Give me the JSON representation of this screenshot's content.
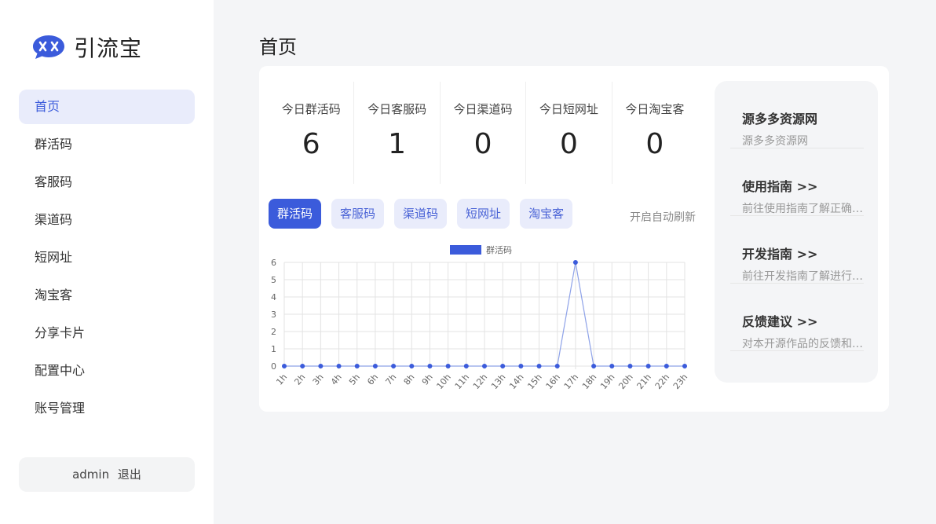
{
  "brand": {
    "name": "引流宝",
    "accent": "#3b5bdb"
  },
  "sidebar": {
    "items": [
      {
        "label": "首页",
        "active": true
      },
      {
        "label": "群活码"
      },
      {
        "label": "客服码"
      },
      {
        "label": "渠道码"
      },
      {
        "label": "短网址"
      },
      {
        "label": "淘宝客"
      },
      {
        "label": "分享卡片"
      },
      {
        "label": "配置中心"
      },
      {
        "label": "账号管理"
      }
    ],
    "user": {
      "name": "admin",
      "logout": "退出"
    }
  },
  "page": {
    "title": "首页"
  },
  "stats": [
    {
      "label": "今日群活码",
      "value": "6"
    },
    {
      "label": "今日客服码",
      "value": "1"
    },
    {
      "label": "今日渠道码",
      "value": "0"
    },
    {
      "label": "今日短网址",
      "value": "0"
    },
    {
      "label": "今日淘宝客",
      "value": "0"
    }
  ],
  "tabs": [
    {
      "label": "群活码",
      "active": true
    },
    {
      "label": "客服码"
    },
    {
      "label": "渠道码"
    },
    {
      "label": "短网址"
    },
    {
      "label": "淘宝客"
    }
  ],
  "auto_refresh": "开启自动刷新",
  "chart_data": {
    "type": "line",
    "categories": [
      "1h",
      "2h",
      "3h",
      "4h",
      "5h",
      "6h",
      "7h",
      "8h",
      "9h",
      "10h",
      "11h",
      "12h",
      "13h",
      "14h",
      "15h",
      "16h",
      "17h",
      "18h",
      "19h",
      "20h",
      "21h",
      "22h",
      "23h"
    ],
    "series": [
      {
        "name": "群活码",
        "values": [
          0,
          0,
          0,
          0,
          0,
          0,
          0,
          0,
          0,
          0,
          0,
          0,
          0,
          0,
          0,
          0,
          6,
          0,
          0,
          0,
          0,
          0,
          0
        ],
        "color": "#3b5bdb"
      }
    ],
    "yticks": [
      "0",
      "1",
      "2",
      "3",
      "4",
      "5",
      "6"
    ],
    "ylim": [
      0,
      6
    ],
    "grid": true,
    "legend": "top-center"
  },
  "side_panel": {
    "items": [
      {
        "title": "源多多资源网",
        "desc": "源多多资源网"
      },
      {
        "title": "使用指南 >>",
        "desc": "前往使用指南了解正确使用方法"
      },
      {
        "title": "开发指南 >>",
        "desc": "前往开发指南了解进行二次开发"
      },
      {
        "title": "反馈建议 >>",
        "desc": "对本开源作品的反馈和建议"
      }
    ]
  }
}
